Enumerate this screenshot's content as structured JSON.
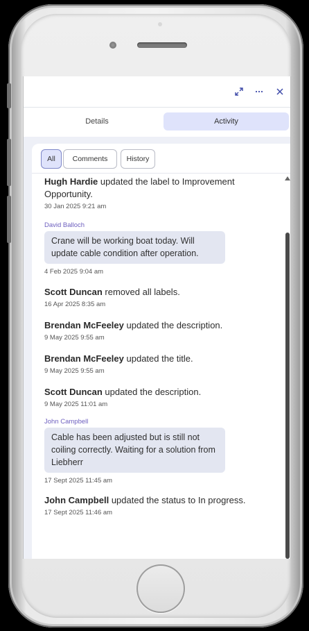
{
  "tabs": [
    {
      "label": "Details",
      "active": false
    },
    {
      "label": "Activity",
      "active": true
    }
  ],
  "filters": [
    {
      "label": "All",
      "active": true
    },
    {
      "label": "Comments",
      "active": false
    },
    {
      "label": "History",
      "active": false
    }
  ],
  "activity": [
    {
      "type": "update",
      "actor": "Hugh Hardie",
      "action": "updated the label to Improvement Opportunity.",
      "timestamp": "30 Jan 2025 9:21 am"
    },
    {
      "type": "comment",
      "author": "David Balloch",
      "body": "Crane will be working boat today. Will update cable condition after operation.",
      "timestamp": "4 Feb 2025 9:04 am"
    },
    {
      "type": "update",
      "actor": "Scott Duncan",
      "action": "removed all labels.",
      "timestamp": "16 Apr 2025 8:35 am"
    },
    {
      "type": "update",
      "actor": "Brendan McFeeley",
      "action": "updated the description.",
      "timestamp": "9 May 2025 9:55 am"
    },
    {
      "type": "update",
      "actor": "Brendan McFeeley",
      "action": "updated the title.",
      "timestamp": "9 May 2025 9:55 am"
    },
    {
      "type": "update",
      "actor": "Scott Duncan",
      "action": "updated the description.",
      "timestamp": "9 May 2025 11:01 am"
    },
    {
      "type": "comment",
      "author": "John Campbell",
      "body": "Cable has been adjusted but is still not coiling correctly. Waiting for a solution from Liebherr",
      "timestamp": "17 Sept 2025 11:45 am"
    },
    {
      "type": "update",
      "actor": "John Campbell",
      "action": "updated the status to In progress.",
      "timestamp": "17 Sept 2025 11:46 am"
    }
  ],
  "colors": {
    "accent": "#3e4aa8",
    "active_tab_bg": "#dfe3fb",
    "comment_bg": "#e3e6f1",
    "author": "#6d5fbf"
  },
  "icons": {
    "expand": "expand-icon",
    "more": "more-icon",
    "close": "close-icon"
  }
}
